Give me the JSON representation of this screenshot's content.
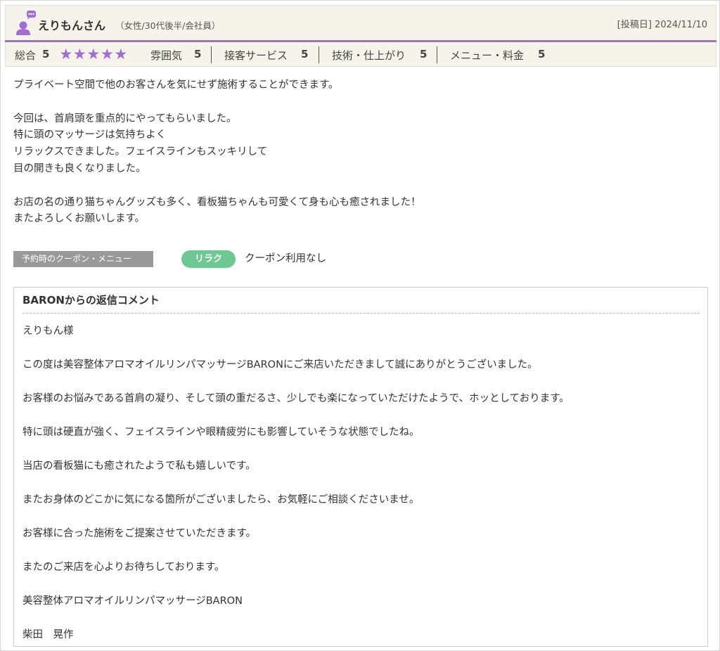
{
  "review": {
    "user_name": "えりもんさん",
    "user_profile": "（女性/30代後半/会社員）",
    "post_date": "[投稿日] 2024/11/10",
    "total_label": "総合",
    "total_value": "5",
    "stars_count": 5,
    "star_glyph": "★",
    "ratings": [
      {
        "label": "雰囲気",
        "value": "5"
      },
      {
        "label": "接客サービス",
        "value": "5"
      },
      {
        "label": "技術・仕上がり",
        "value": "5"
      },
      {
        "label": "メニュー・料金",
        "value": "5"
      }
    ],
    "body_lines": [
      "プライベート空間で他のお客さんを気にせず施術することができます。",
      "",
      "今回は、首肩頭を重点的にやってもらいました。",
      "特に頭のマッサージは気持ちよく",
      "リラックスできました。フェイスラインもスッキリして",
      "目の開きも良くなりました。",
      "",
      "お店の名の通り猫ちゃんグッズも多く、看板猫ちゃんも可愛くて身も心も癒されました！",
      "またよろしくお願いします。"
    ],
    "coupon_label": "予約時のクーポン・メニュー",
    "coupon_tag": "リラク",
    "coupon_text": "クーポン利用なし"
  },
  "reply": {
    "title": "BARONからの返信コメント",
    "lines": [
      "えりもん様",
      "",
      "この度は美容整体アロマオイルリンパマッサージBARONにご来店いただきまして誠にありがとうございました。",
      "",
      "お客様のお悩みである首肩の凝り、そして頭の重だるさ、少しでも楽になっていただけたようで、ホッとしております。",
      "",
      "特に頭は硬直が強く、フェイスラインや眼精疲労にも影響していそうな状態でしたね。",
      "",
      "当店の看板猫にも癒されたようで私も嬉しいです。",
      "",
      "またお身体のどこかに気になる箇所がございましたら、お気軽にご相談くださいませ。",
      "",
      "お客様に合った施術をご提案させていただきます。",
      "",
      "またのご来店を心よりお待ちしております。",
      "",
      "美容整体アロマオイルリンパマッサージBARON",
      "",
      "柴田　晃作"
    ]
  },
  "colors": {
    "accent_purple": "#a26bd6",
    "header_bg": "#f6f3ea",
    "coupon_green": "#6ec891",
    "coupon_gray": "#999999"
  },
  "icons": {
    "avatar": "user-speech-bubble-icon",
    "star": "star-icon"
  }
}
